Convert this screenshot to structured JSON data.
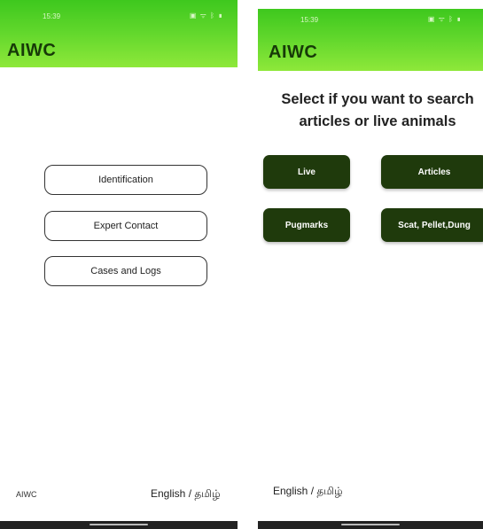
{
  "left_screen": {
    "status": {
      "time": "15:39",
      "icons": "▣ ᯤ ᛒ ▮"
    },
    "app_title": "AIWC",
    "menu": [
      {
        "label": "Identification"
      },
      {
        "label": "Expert Contact"
      },
      {
        "label": "Cases and Logs"
      }
    ],
    "footer": {
      "app_name": "AIWC",
      "language": "English / தமிழ்"
    }
  },
  "right_screen": {
    "status": {
      "time": "15:39",
      "icons": "▣ ᯤ ᛒ ▮"
    },
    "app_title": "AIWC",
    "headline_line1": "Select if you want to search",
    "headline_line2": "articles or live animals",
    "buttons": [
      {
        "label": "Live"
      },
      {
        "label": "Articles"
      },
      {
        "label": "Pugmarks"
      },
      {
        "label": "Scat, Pellet,Dung"
      }
    ],
    "footer": {
      "language": "English / தமிழ்"
    }
  },
  "colors": {
    "appbar_green": "#5fd62b",
    "dark_button": "#1f3a0c",
    "title_text": "#173a08"
  }
}
